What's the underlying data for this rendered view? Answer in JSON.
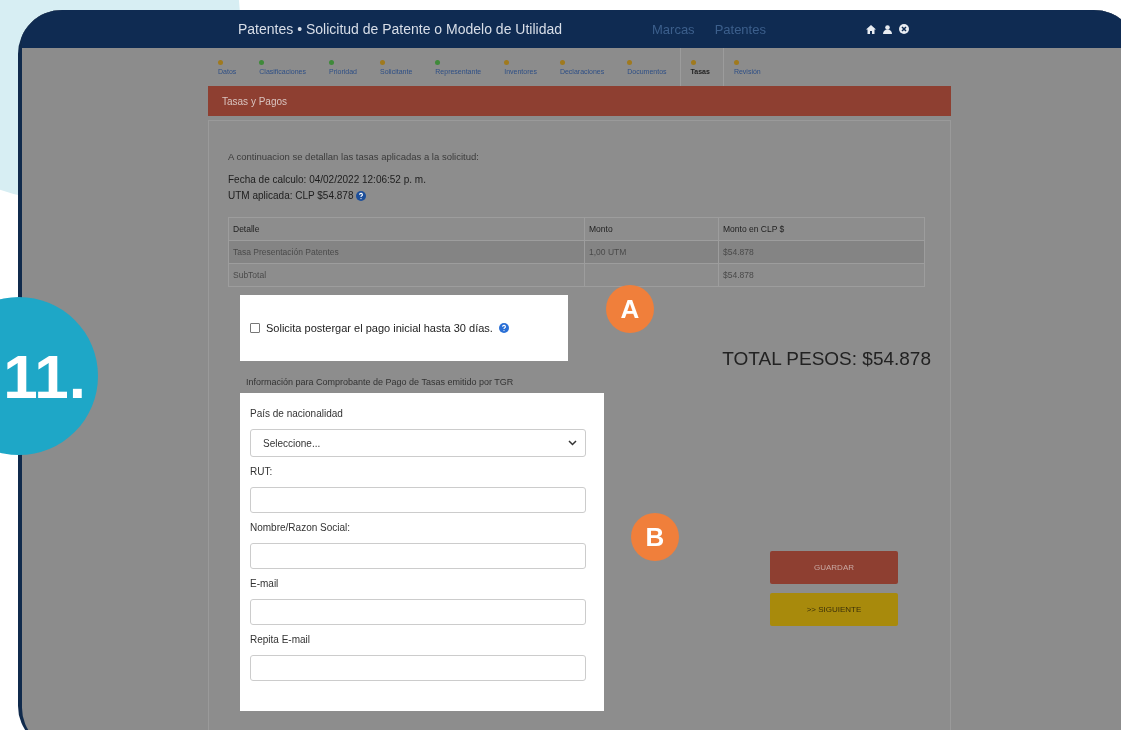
{
  "step_number": "11.",
  "header": {
    "title": "Patentes • Solicitud de Patente o Modelo de Utilidad",
    "nav": [
      "Marcas",
      "Patentes"
    ]
  },
  "steps": [
    {
      "label": "Datos",
      "color": "#a07a1e",
      "selected": false
    },
    {
      "label": "Clasificaciones",
      "color": "#3f8a3a",
      "selected": false
    },
    {
      "label": "Prioridad",
      "color": "#3f8a3a",
      "selected": false
    },
    {
      "label": "Solicitante",
      "color": "#a07a1e",
      "selected": false
    },
    {
      "label": "Representante",
      "color": "#3f8a3a",
      "selected": false
    },
    {
      "label": "Inventores",
      "color": "#a07a1e",
      "selected": false
    },
    {
      "label": "Declaraciones",
      "color": "#a07a1e",
      "selected": false
    },
    {
      "label": "Documentos",
      "color": "#a07a1e",
      "selected": false
    },
    {
      "label": "Tasas",
      "color": "#a07a1e",
      "selected": true
    },
    {
      "label": "Revisión",
      "color": "#a07a1e",
      "selected": false
    }
  ],
  "panel_title": "Tasas y Pagos",
  "intro": "A continuacion se detallan las tasas aplicadas a la solicitud:",
  "fecha": "Fecha de calculo: 04/02/2022 12:06:52 p. m.",
  "utm": "UTM aplicada: CLP $54.878",
  "table": {
    "columns": [
      "Detalle",
      "Monto",
      "Monto en CLP $"
    ],
    "rows": [
      [
        "Tasa Presentación Patentes",
        "1,00 UTM",
        "$54.878"
      ],
      [
        "SubTotal",
        "",
        "$54.878"
      ]
    ]
  },
  "postpone": {
    "label": "Solicita postergar el pago inicial hasta 30 días.",
    "checked": false
  },
  "total": "TOTAL PESOS: $54.878",
  "receipt_title": "Información para Comprobante de Pago de Tasas emitido por TGR",
  "fields": [
    {
      "kind": "select",
      "label": "País de nacionalidad",
      "value": "Seleccione..."
    },
    {
      "kind": "text",
      "label": "RUT:"
    },
    {
      "kind": "text",
      "label": "Nombre/Razon Social:"
    },
    {
      "kind": "text",
      "label": "E-mail"
    },
    {
      "kind": "text",
      "label": "Repita E-mail"
    }
  ],
  "buttons": [
    {
      "kind": "save",
      "label": "GUARDAR"
    },
    {
      "kind": "next",
      "label": ">> SIGUIENTE"
    }
  ],
  "markers": [
    "A",
    "B"
  ]
}
